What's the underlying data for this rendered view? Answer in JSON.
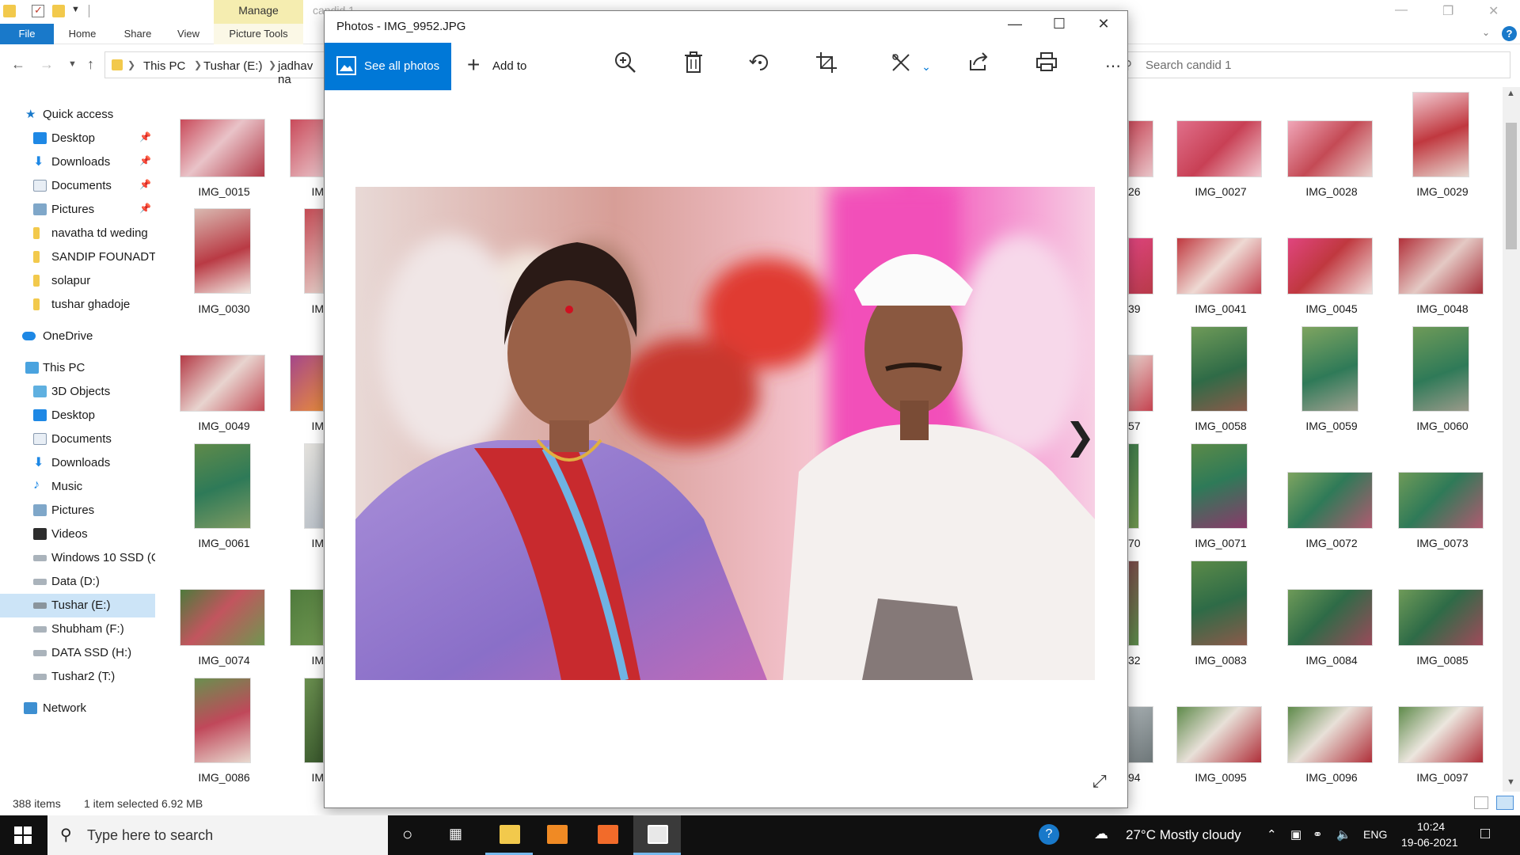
{
  "explorer": {
    "contextual_tab": "Manage",
    "faded_title": "candid 1",
    "ribbon_tabs": [
      "File",
      "Home",
      "Share",
      "View",
      "Picture Tools"
    ],
    "breadcrumb": [
      "This PC",
      "Tushar (E:)",
      "jadhav na"
    ],
    "search_placeholder": "Search candid 1",
    "nav_pane": {
      "quick_access": "Quick access",
      "pinned": [
        "Desktop",
        "Downloads",
        "Documents",
        "Pictures"
      ],
      "folders": [
        "navatha td weding",
        "SANDIP FOUNADTI",
        "solapur",
        "tushar ghadoje"
      ],
      "onedrive": "OneDrive",
      "this_pc": "This PC",
      "this_pc_items": [
        "3D Objects",
        "Desktop",
        "Documents",
        "Downloads",
        "Music",
        "Pictures",
        "Videos",
        "Windows 10 SSD (C",
        "Data (D:)",
        "Tushar (E:)",
        "Shubham (F:)",
        "DATA SSD (H:)",
        "Tushar2 (T:)"
      ],
      "network": "Network"
    },
    "left_files": [
      "IMG_0015",
      "IMG_0030",
      "IMG_0049",
      "IMG_0061",
      "IMG_0074",
      "IMG_0086"
    ],
    "right_files": [
      [
        "IMG_0027",
        "IMG_0028",
        "IMG_0029"
      ],
      [
        "IMG_0041",
        "IMG_0045",
        "IMG_0048"
      ],
      [
        "IMG_0058",
        "IMG_0059",
        "IMG_0060"
      ],
      [
        "IMG_0071",
        "IMG_0072",
        "IMG_0073"
      ],
      [
        "IMG_0083",
        "IMG_0084",
        "IMG_0085"
      ],
      [
        "IMG_0095",
        "IMG_0096",
        "IMG_0097"
      ]
    ],
    "partial_labels": [
      "IM",
      "26",
      "39",
      "57",
      "70",
      "32",
      "94"
    ],
    "status": {
      "count": "388 items",
      "selected": "1 item selected  6.92 MB"
    }
  },
  "photos": {
    "title": "Photos - IMG_9952.JPG",
    "see_all": "See all photos",
    "add_to": "Add to"
  },
  "taskbar": {
    "search_placeholder": "Type here to search",
    "weather": "27°C  Mostly cloudy",
    "lang": "ENG",
    "time": "10:24",
    "date": "19-06-2021"
  },
  "colors": {
    "accent": "#0078d7",
    "file_tab": "#1979ca",
    "manage_tab": "#f5edb0"
  }
}
